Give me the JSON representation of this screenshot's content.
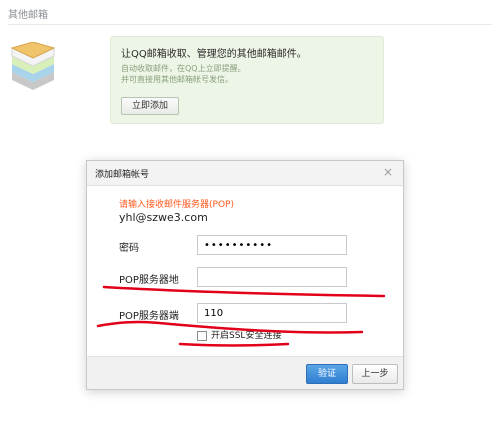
{
  "header": {
    "title": "其他邮箱"
  },
  "promo": {
    "title": "让QQ邮箱收取、管理您的其他邮箱邮件。",
    "desc_line1": "自动收取邮件，在QQ上立即提醒。",
    "desc_line2": "并可直接用其他邮箱帐号发信。",
    "add_label": "立即添加"
  },
  "dialog": {
    "title": "添加邮箱帐号",
    "close": "×",
    "hint": "请输入接收邮件服务器(POP)",
    "email": "yhl@szwe3.com",
    "fields": {
      "password_label": "密码",
      "password_value": "••••••••••",
      "pop_server_label": "POP服务器地",
      "pop_server_value": "",
      "pop_port_label": "POP服务器端",
      "pop_port_value": "110"
    },
    "ssl_label": "开启SSL安全连接",
    "verify_label": "验证",
    "prev_label": "上一步"
  },
  "colors": {
    "hint": "#ff5a1e",
    "primary_button": "#2f7fd1",
    "annotation": "#e2001a"
  }
}
